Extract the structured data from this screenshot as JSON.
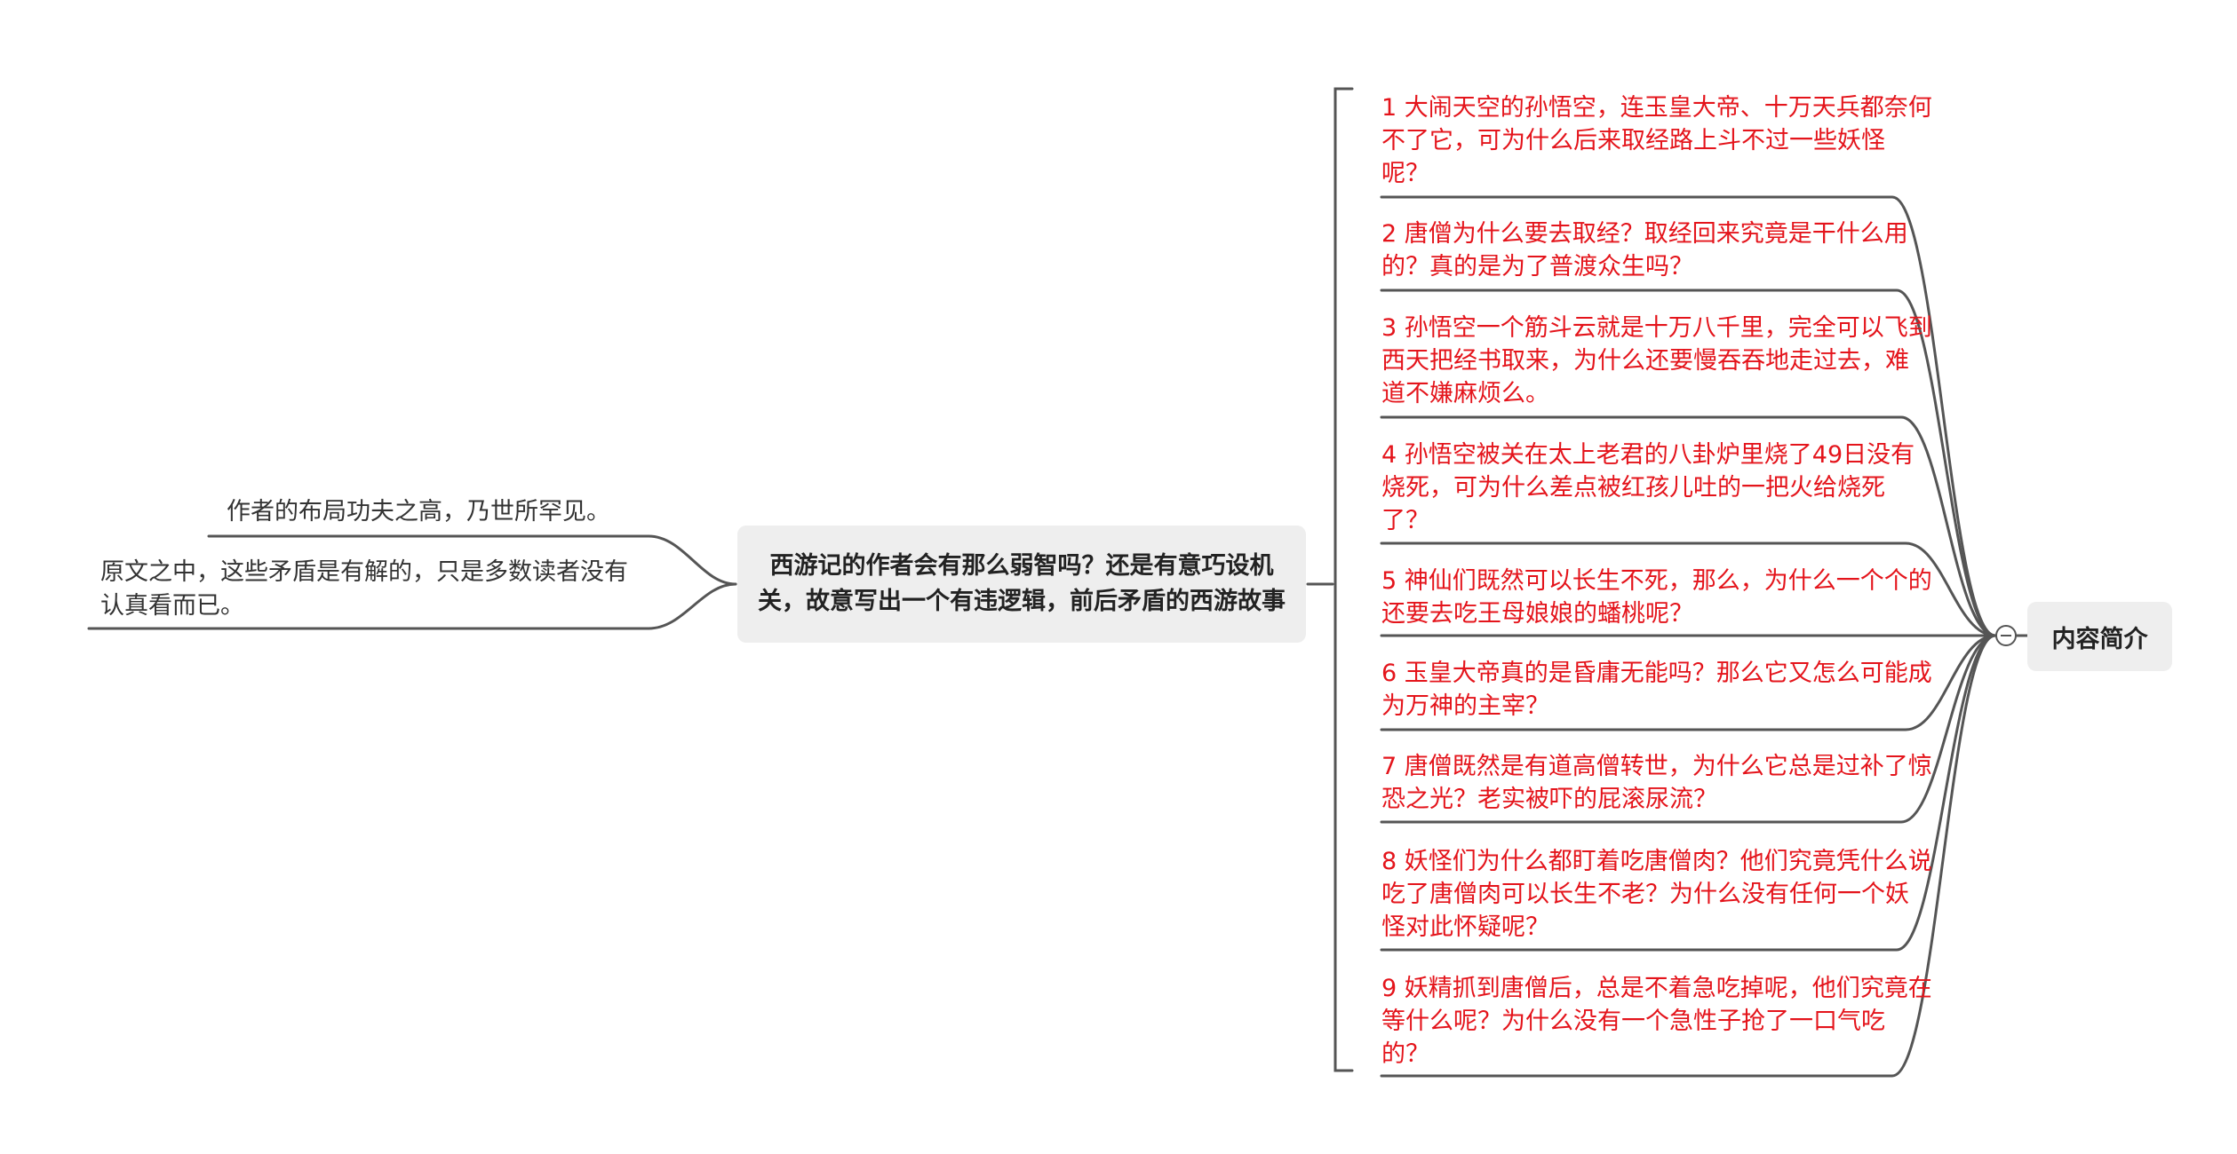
{
  "central_topic": "内容简介",
  "main_topic": "西游记的作者会有那么弱智吗？还是有意巧设机关，故意写出一个有违逻辑，前后矛盾的西游故事",
  "items": [
    "1 大闹天空的孙悟空，连玉皇大帝、十万天兵都奈何不了它，可为什么后来取经路上斗不过一些妖怪呢？",
    "2 唐僧为什么要去取经？取经回来究竟是干什么用的？真的是为了普渡众生吗？",
    "3 孙悟空一个筋斗云就是十万八千里，完全可以飞到西天把经书取来，为什么还要慢吞吞地走过去，难道不嫌麻烦么。",
    "4 孙悟空被关在太上老君的八卦炉里烧了49日没有烧死，可为什么差点被红孩儿吐的一把火给烧死了？",
    "5 神仙们既然可以长生不死，那么，为什么一个个的还要去吃王母娘娘的蟠桃呢？",
    "6 玉皇大帝真的是昏庸无能吗？那么它又怎么可能成为万神的主宰？",
    "7 唐僧既然是有道高僧转世，为什么它总是过补了惊恐之光？老实被吓的屁滚尿流？",
    "8 妖怪们为什么都盯着吃唐僧肉？他们究竟凭什么说吃了唐僧肉可以长生不老？为什么没有任何一个妖怪对此怀疑呢？",
    "9 妖精抓到唐僧后，总是不着急吃掉呢，他们究竟在等什么呢？为什么没有一个急性子抢了一口气吃的？"
  ],
  "notes": [
    "作者的布局功夫之高，乃世所罕见。",
    "原文之中，这些矛盾是有解的，只是多数读者没有认真看而已。"
  ],
  "colors": {
    "item_text": "#e4141b",
    "line": "#555555",
    "node_fill": "#eeeeee"
  }
}
